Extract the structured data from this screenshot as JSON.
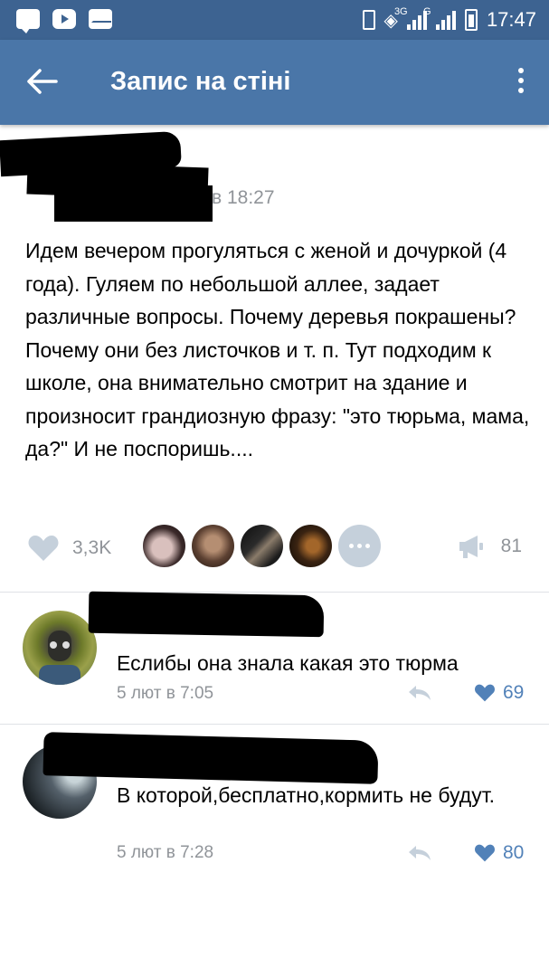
{
  "status_bar": {
    "network_3g": "3G",
    "network_g": "G",
    "time": "17:47",
    "icons": [
      "chat-icon",
      "youtube-icon",
      "mail-icon",
      "vibrate-icon",
      "wifi-icon",
      "signal-icon",
      "battery-icon"
    ]
  },
  "app_bar": {
    "title": "Запис на стіні"
  },
  "post": {
    "time": "в 18:27",
    "text": "Идем вечером прогуляться с женой и дочуркой (4 года). Гуляем по небольшой аллее, задает различные вопросы. Почему деревья покрашены? Почему они без листочков и т. п. Тут подходим к школе, она внимательно смотрит на здание и произносит грандиозную фразу: \"это тюрьма, мама, да?\" И не поспоришь....",
    "likes": "3,3K",
    "shares": "81"
  },
  "comments": [
    {
      "text": "Еслибы она знала какая это тюрма",
      "date": "5 лют в 7:05",
      "likes": "69"
    },
    {
      "text": "В которой,бесплатно,кормить не будут.",
      "date": "5 лют в 7:28",
      "likes": "80"
    }
  ],
  "colors": {
    "status_bar": "#3d6391",
    "app_bar": "#4a76a8",
    "secondary_text": "#909499",
    "like_accent": "#5181b8"
  }
}
